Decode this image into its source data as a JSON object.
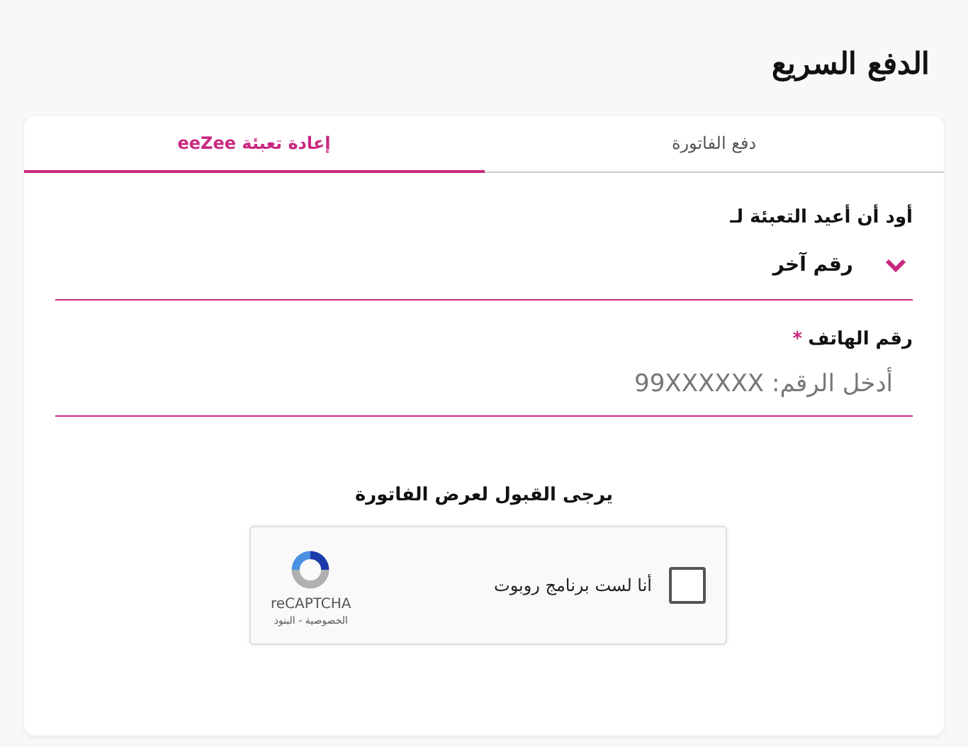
{
  "page_title": "الدفع السريع",
  "tabs": [
    {
      "label": "دفع الفاتورة",
      "selected": false
    },
    {
      "label": "إعادة تعبئة eeZee",
      "selected": true
    }
  ],
  "recharge_for": {
    "label": "أود أن أعيد التعبئة لـ",
    "value": "رقم آخر",
    "expanded": false
  },
  "phone": {
    "label": "رقم الهاتف",
    "required_mark": "*",
    "placeholder": "أدخل الرقم: 99XXXXXX"
  },
  "captcha": {
    "heading": "يرجى القبول لعرض الفاتورة",
    "checkbox_label": "أنا لست برنامج روبوت",
    "checked": false,
    "brand": "reCAPTCHA",
    "links": "الخصوصية - البنود"
  }
}
